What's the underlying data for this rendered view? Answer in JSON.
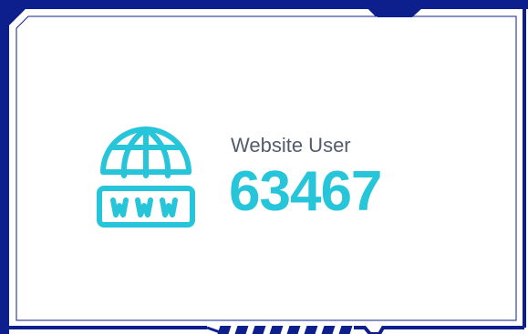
{
  "widget": {
    "label": "Website User",
    "value": "63467",
    "icon": "www-globe-icon",
    "colors": {
      "frame": "#0d1f8c",
      "accent": "#27c5d9",
      "label": "#555b6e",
      "background": "#ffffff"
    }
  }
}
